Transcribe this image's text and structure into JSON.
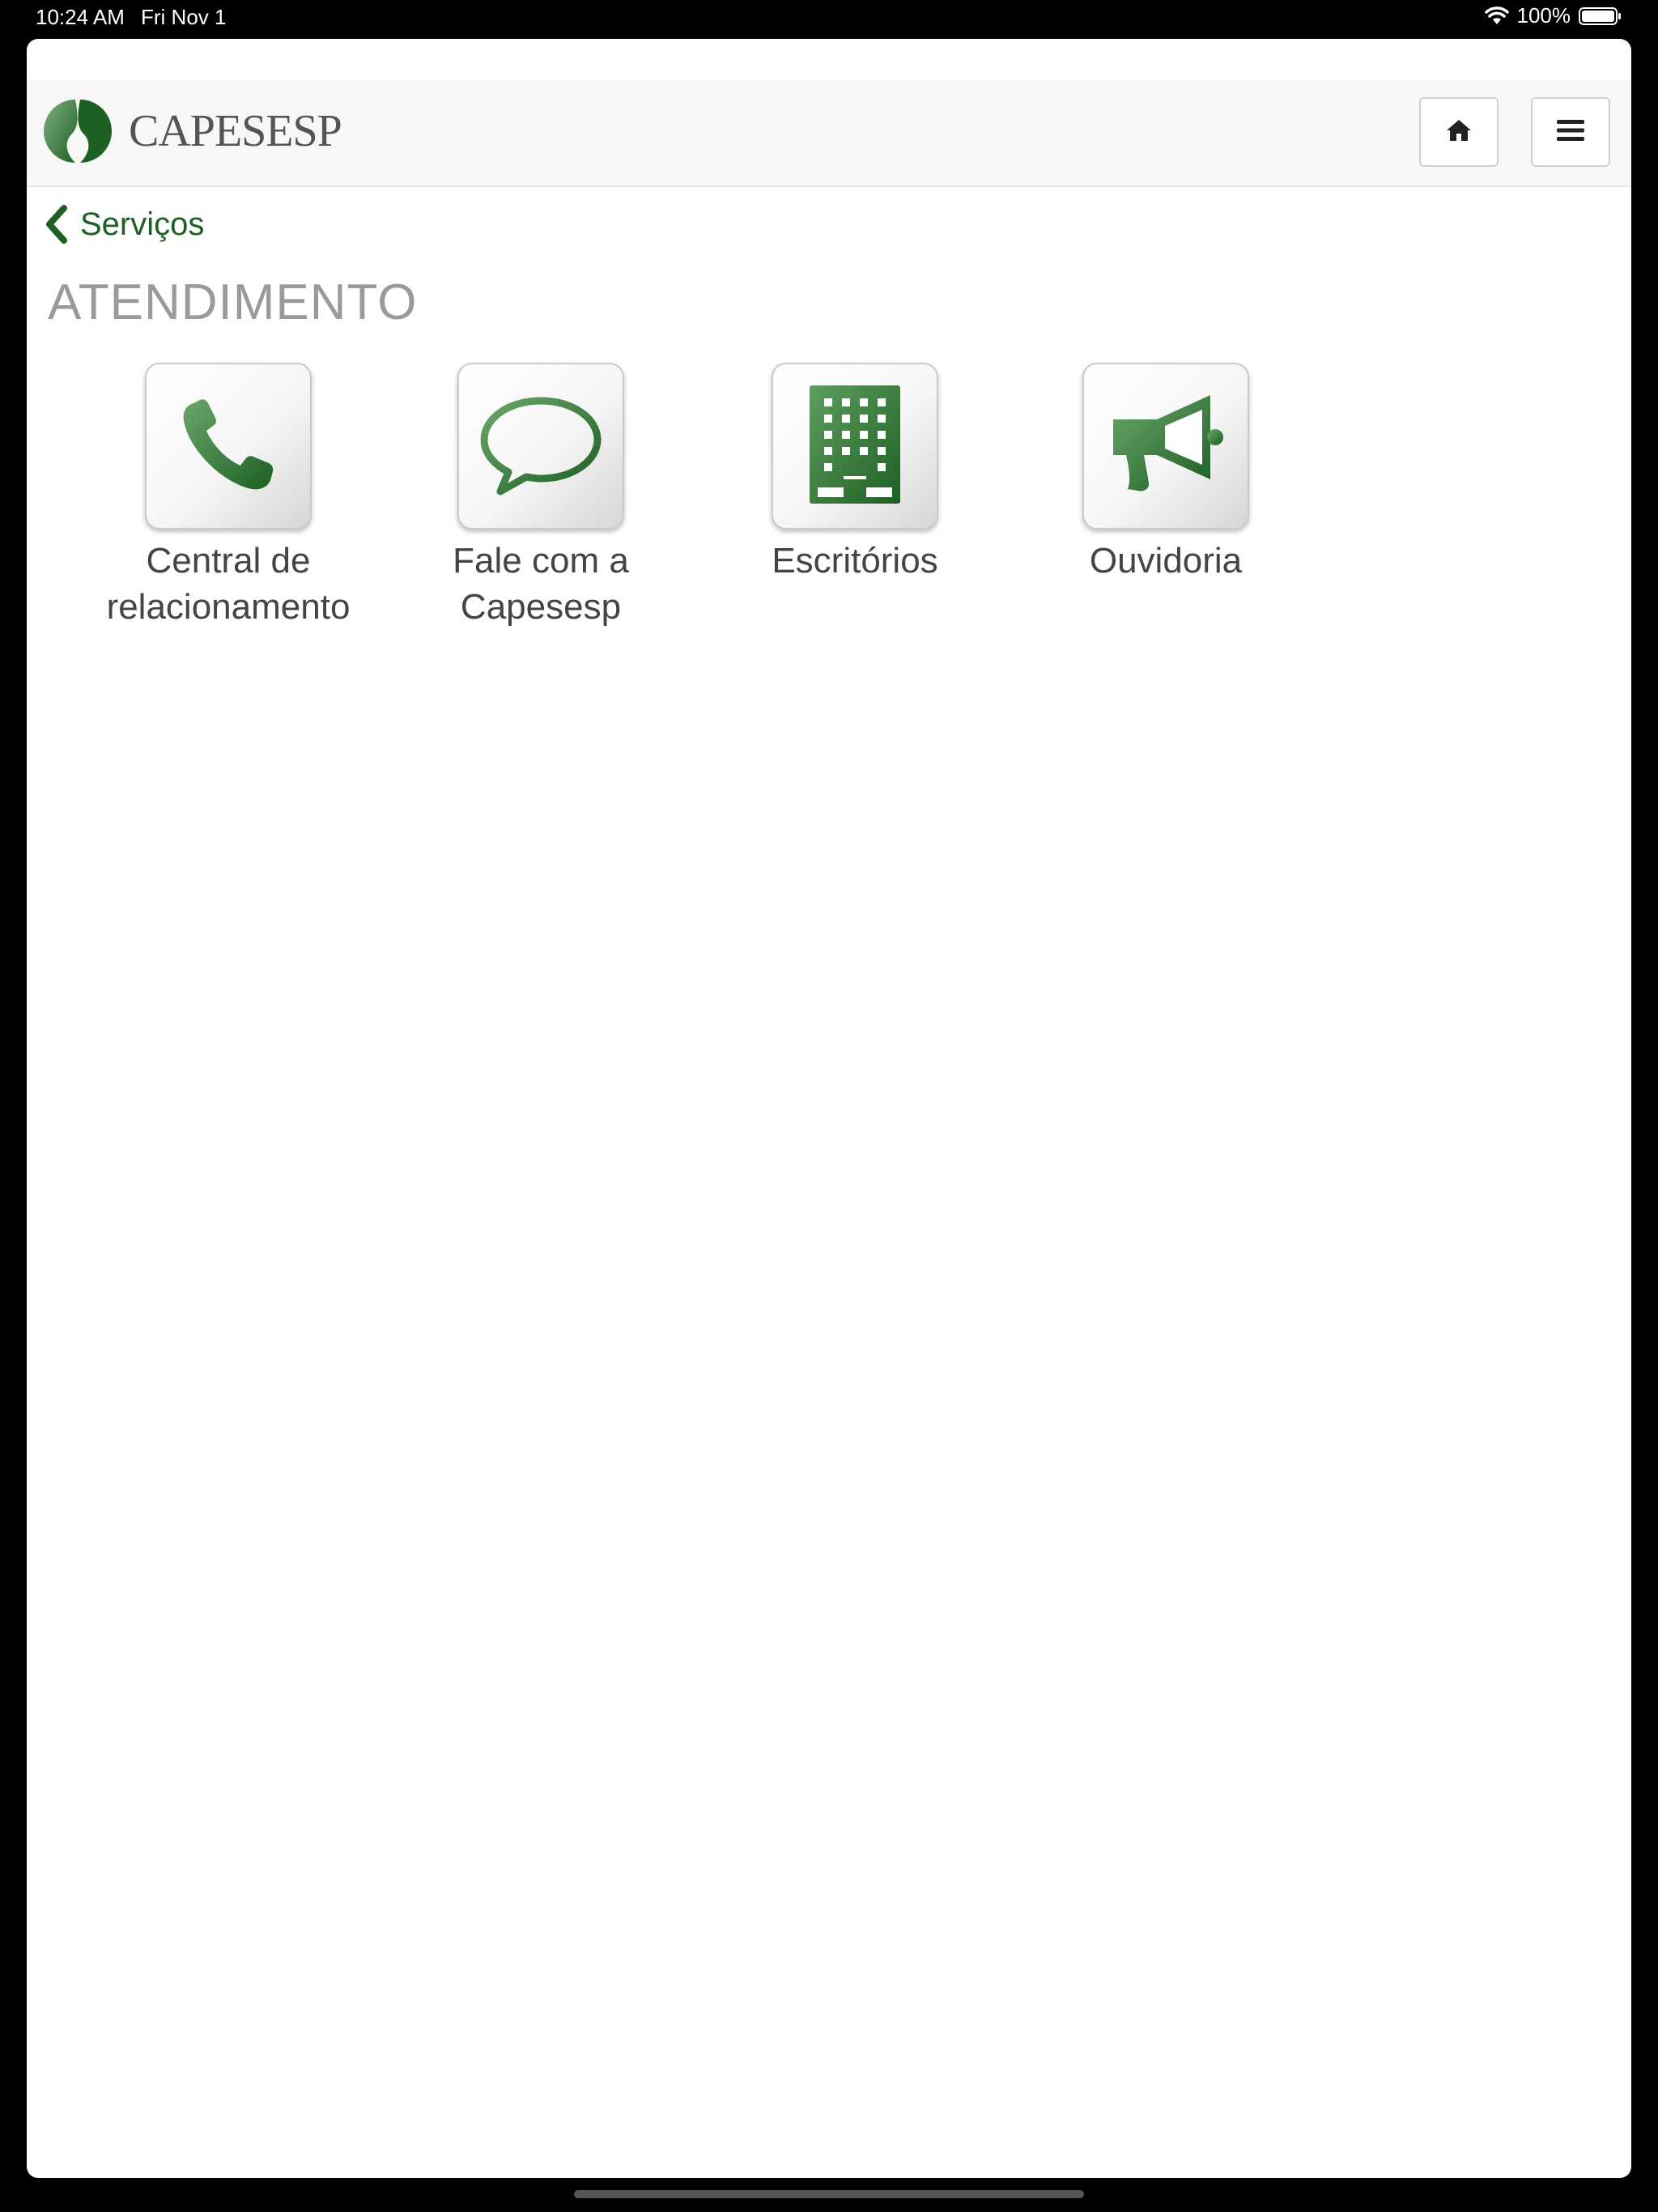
{
  "status_bar": {
    "time": "10:24 AM",
    "date": "Fri Nov 1",
    "battery": "100%"
  },
  "header": {
    "brand": "CAPESESP",
    "home_icon": "home-icon",
    "menu_icon": "hamburger-menu-icon"
  },
  "nav": {
    "back_label": "Serviços"
  },
  "page": {
    "title": "ATENDIMENTO"
  },
  "tiles": [
    {
      "label_line1": "Central de",
      "label_line2": "relacionamento",
      "icon": "phone-icon"
    },
    {
      "label_line1": "Fale com a",
      "label_line2": "Capesesp",
      "icon": "speech-bubble-icon"
    },
    {
      "label_line1": "Escritórios",
      "label_line2": "",
      "icon": "building-icon"
    },
    {
      "label_line1": "Ouvidoria",
      "label_line2": "",
      "icon": "megaphone-icon"
    }
  ],
  "colors": {
    "brand_green": "#1e5f24",
    "title_gray": "#9a9a9a"
  }
}
